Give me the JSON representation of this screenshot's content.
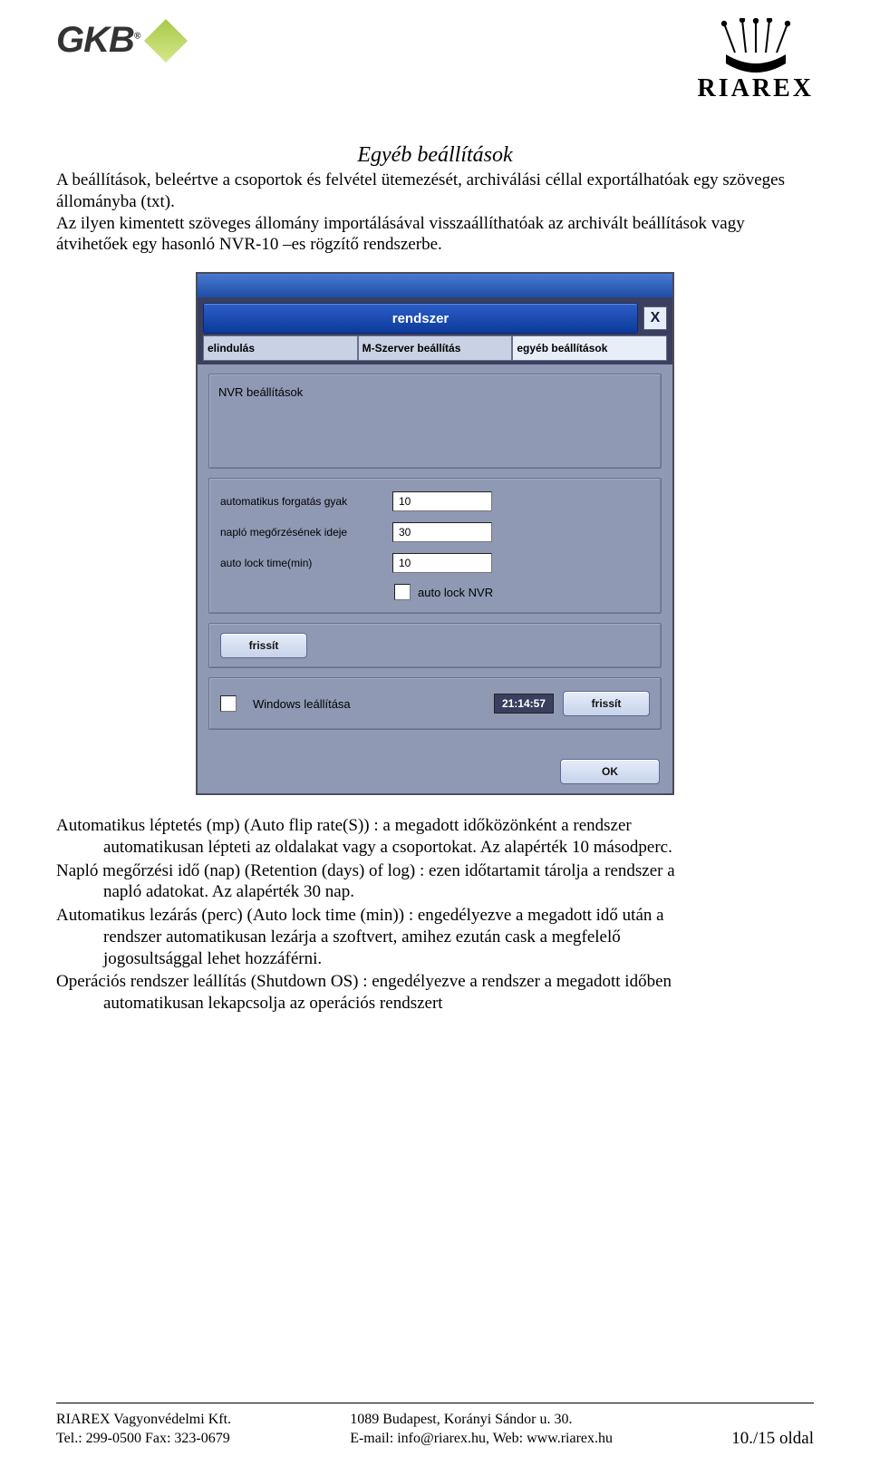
{
  "header": {
    "gkb": "GKB",
    "riarex": "RIAREX"
  },
  "section_title": "Egyéb beállítások",
  "intro_p1": "A beállítások, beleértve a csoportok és felvétel ütemezését, archiválási céllal exportálhatóak egy szöveges állományba (txt).",
  "intro_p2": "Az ilyen kimentett szöveges állomány importálásával visszaállíthatóak az archivált beállítások vagy átvihetőek egy hasonló NVR-10 –es rögzítő rendszerbe.",
  "dialog": {
    "title": "rendszer",
    "close": "X",
    "tabs": {
      "t1": "elindulás",
      "t2": "M-Szerver beállítás",
      "t3": "egyéb beállítások"
    },
    "nvr_label": "NVR beállítások",
    "rows": {
      "auto_rotate_label": "automatikus forgatás gyak",
      "auto_rotate_val": "10",
      "log_retain_label": "napló megőrzésének ideje",
      "log_retain_val": "30",
      "auto_lock_label": "auto lock time(min)",
      "auto_lock_val": "10",
      "auto_lock_nvr": "auto lock NVR"
    },
    "btn_refresh": "frissít",
    "shutdown_label": "Windows leállítása",
    "time": "21:14:57",
    "btn_refresh2": "frissít",
    "btn_ok": "OK"
  },
  "desc": {
    "p1a": "Automatikus léptetés (mp) (Auto flip rate(S)) : a megadott időközönként a rendszer",
    "p1b": "automatikusan lépteti az oldalakat vagy a csoportokat. Az alapérték 10 másodperc.",
    "p2a": "Napló megőrzési idő (nap) (Retention (days) of log) : ezen időtartamit tárolja a rendszer a",
    "p2b": "napló adatokat. Az alapérték 30 nap.",
    "p3a": "Automatikus lezárás (perc) (Auto lock time (min)) : engedélyezve a megadott idő után a",
    "p3b": "rendszer automatikusan lezárja a szoftvert, amihez ezután cask a megfelelő",
    "p3c": "jogosultsággal lehet hozzáférni.",
    "p4a": "Operációs rendszer leállítás (Shutdown OS) : engedélyezve a rendszer a megadott időben",
    "p4b": "automatikusan lekapcsolja az operációs rendszert"
  },
  "footer": {
    "company": "RIAREX  Vagyonvédelmi Kft.",
    "phones": "Tel.: 299-0500     Fax: 323-0679",
    "addr": "1089 Budapest, Korányi Sándor u. 30.",
    "contact": "E-mail: info@riarex.hu,         Web: www.riarex.hu",
    "page": "10./15 oldal"
  }
}
